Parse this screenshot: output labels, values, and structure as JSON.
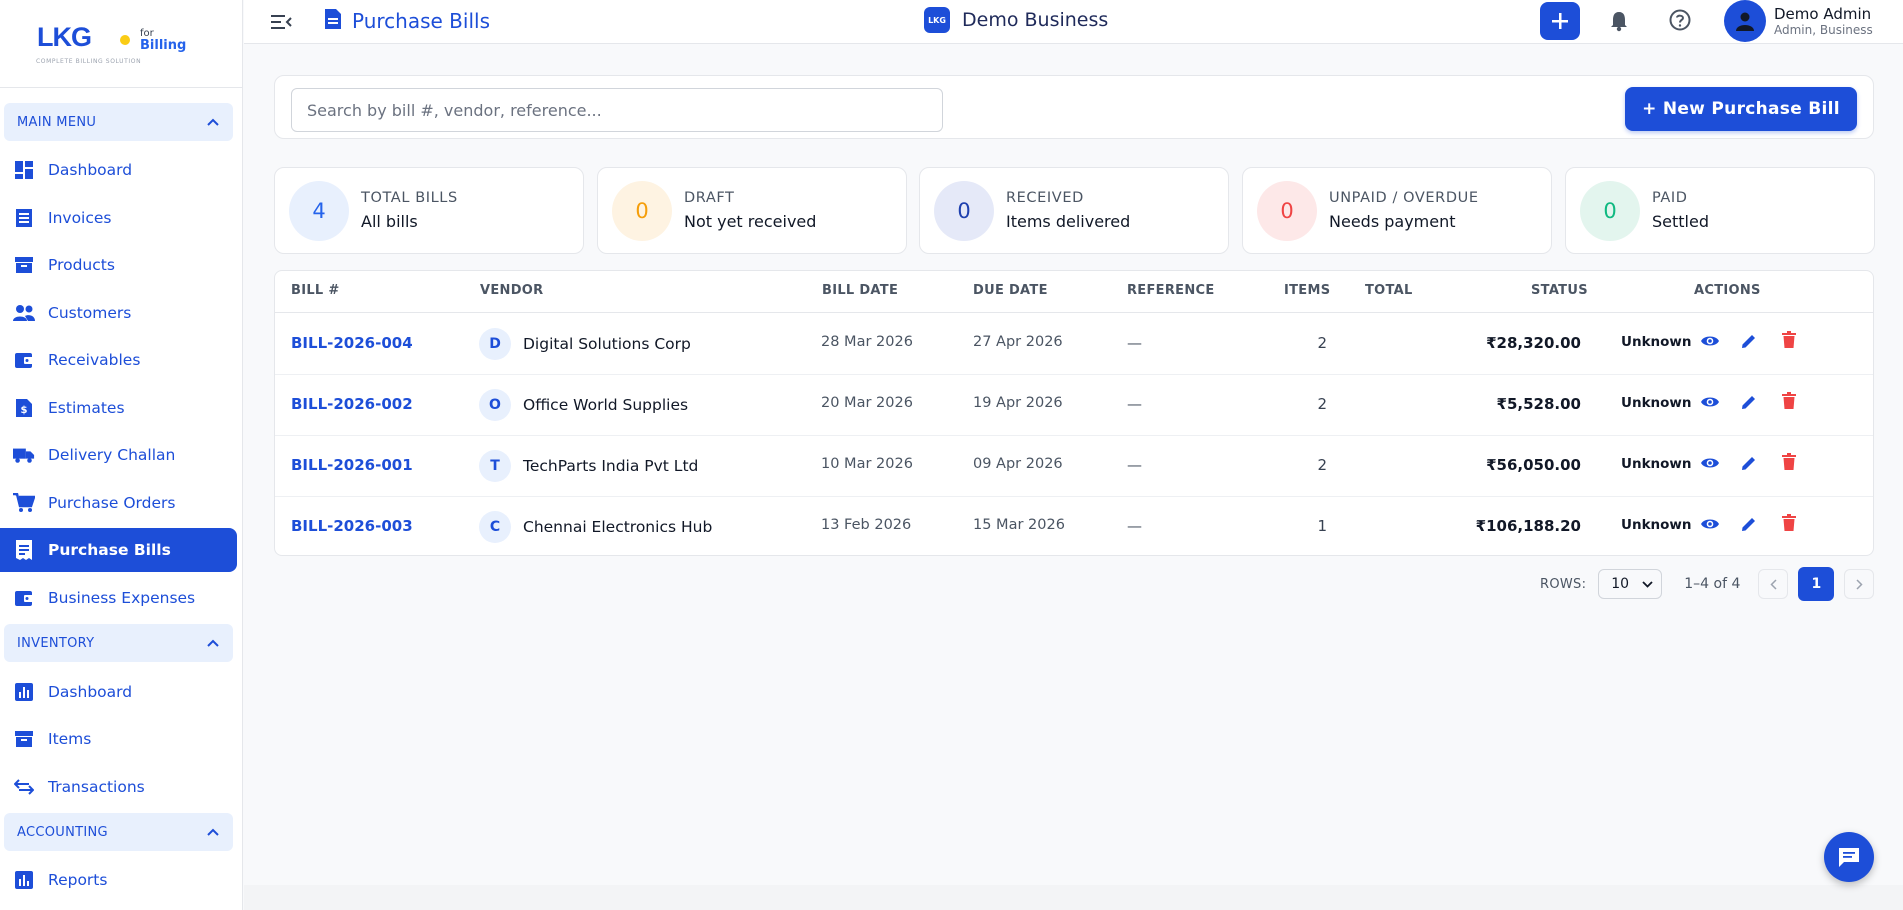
{
  "logo": {
    "brand": "LKG",
    "for": "for",
    "product": "Billing",
    "tagline": "COMPLETE BILLING SOLUTION"
  },
  "sidebar": {
    "sections": [
      {
        "label": "MAIN MENU",
        "chevron": "chevron-up-icon"
      },
      {
        "label": "INVENTORY",
        "chevron": "chevron-up-icon"
      },
      {
        "label": "ACCOUNTING",
        "chevron": "chevron-up-icon"
      }
    ],
    "items": [
      {
        "label": "Dashboard",
        "icon": "dashboard-icon"
      },
      {
        "label": "Invoices",
        "icon": "invoice-icon"
      },
      {
        "label": "Products",
        "icon": "archive-icon"
      },
      {
        "label": "Customers",
        "icon": "people-icon"
      },
      {
        "label": "Receivables",
        "icon": "wallet-icon"
      },
      {
        "label": "Estimates",
        "icon": "estimate-icon"
      },
      {
        "label": "Delivery Challan",
        "icon": "truck-icon"
      },
      {
        "label": "Purchase Orders",
        "icon": "cart-icon"
      },
      {
        "label": "Purchase Bills",
        "icon": "receipt-icon",
        "active": true
      },
      {
        "label": "Business Expenses",
        "icon": "wallet-icon"
      },
      {
        "label": "Dashboard",
        "icon": "chart-icon"
      },
      {
        "label": "Items",
        "icon": "archive-icon"
      },
      {
        "label": "Transactions",
        "icon": "swap-icon"
      },
      {
        "label": "Reports",
        "icon": "bar-chart-icon"
      }
    ]
  },
  "topbar": {
    "title": "Purchase Bills",
    "business_badge": "LKG",
    "business": "Demo Business",
    "user_name": "Demo Admin",
    "user_role": "Admin, Business"
  },
  "toolbar": {
    "search_placeholder": "Search by bill #, vendor, reference...",
    "new_button": "+ New Purchase Bill"
  },
  "stats": [
    {
      "count": "4",
      "label": "TOTAL BILLS",
      "sub": "All bills",
      "bg": "#e8f0fd",
      "fg": "#2563eb"
    },
    {
      "count": "0",
      "label": "DRAFT",
      "sub": "Not yet received",
      "bg": "#fef3e2",
      "fg": "#f59e0b"
    },
    {
      "count": "0",
      "label": "RECEIVED",
      "sub": "Items delivered",
      "bg": "#e5e9f8",
      "fg": "#1e40af"
    },
    {
      "count": "0",
      "label": "UNPAID / OVERDUE",
      "sub": "Needs payment",
      "bg": "#fde8e8",
      "fg": "#ef4444"
    },
    {
      "count": "0",
      "label": "PAID",
      "sub": "Settled",
      "bg": "#e3f5ee",
      "fg": "#10b981"
    }
  ],
  "table": {
    "headers": [
      "BILL #",
      "VENDOR",
      "BILL DATE",
      "DUE DATE",
      "REFERENCE",
      "ITEMS",
      "TOTAL",
      "STATUS",
      "ACTIONS"
    ],
    "rows": [
      {
        "bill": "BILL-2026-004",
        "initial": "D",
        "vendor": "Digital Solutions Corp",
        "bill_date": "28 Mar 2026",
        "due_date": "27 Apr 2026",
        "reference": "—",
        "items": "2",
        "total": "₹28,320.00",
        "status": "Unknown"
      },
      {
        "bill": "BILL-2026-002",
        "initial": "O",
        "vendor": "Office World Supplies",
        "bill_date": "20 Mar 2026",
        "due_date": "19 Apr 2026",
        "reference": "—",
        "items": "2",
        "total": "₹5,528.00",
        "status": "Unknown"
      },
      {
        "bill": "BILL-2026-001",
        "initial": "T",
        "vendor": "TechParts India Pvt Ltd",
        "bill_date": "10 Mar 2026",
        "due_date": "09 Apr 2026",
        "reference": "—",
        "items": "2",
        "total": "₹56,050.00",
        "status": "Unknown"
      },
      {
        "bill": "BILL-2026-003",
        "initial": "C",
        "vendor": "Chennai Electronics Hub",
        "bill_date": "13 Feb 2026",
        "due_date": "15 Mar 2026",
        "reference": "—",
        "items": "1",
        "total": "₹106,188.20",
        "status": "Unknown"
      }
    ]
  },
  "pagination": {
    "rows_label": "ROWS:",
    "rows_value": "10",
    "range": "1–4 of 4",
    "page": "1"
  },
  "colors": {
    "accent": "#1d4ed8",
    "delete": "#ef4444"
  }
}
